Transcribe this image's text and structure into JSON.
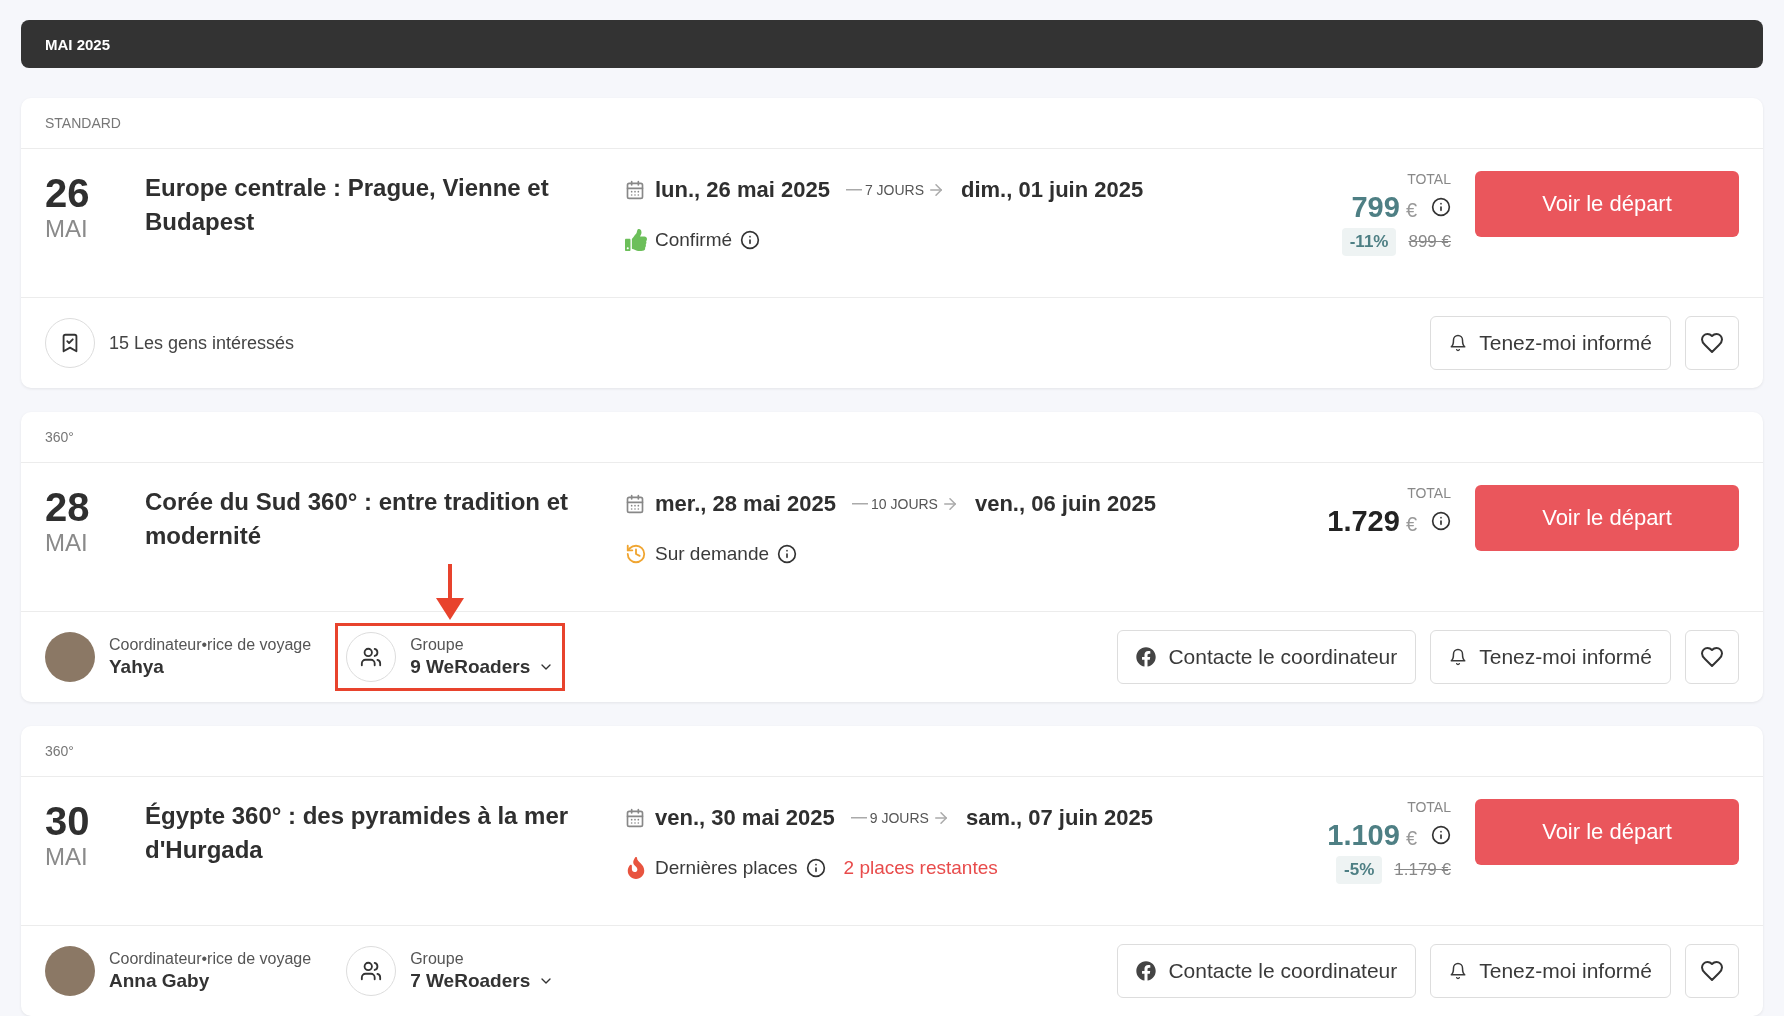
{
  "month_header": "MAI 2025",
  "departures": [
    {
      "category": "STANDARD",
      "day": "26",
      "month": "MAI",
      "title": "Europe centrale : Prague, Vienne et Budapest",
      "start_date": "lun., 26 mai 2025",
      "duration": "7 JOURS",
      "end_date": "dim., 01 juin 2025",
      "status": {
        "kind": "confirmed",
        "label": "Confirmé"
      },
      "total_label": "TOTAL",
      "price": "799",
      "currency": "€",
      "discount": "-11%",
      "old_price": "899 €",
      "cta": "Voir le départ",
      "interested": "15 Les gens intéressés",
      "notify": "Tenez-moi informé"
    },
    {
      "category": "360°",
      "day": "28",
      "month": "MAI",
      "title": "Corée du Sud 360° : entre tradition et modernité",
      "start_date": "mer., 28 mai 2025",
      "duration": "10 JOURS",
      "end_date": "ven., 06 juin 2025",
      "status": {
        "kind": "on_request",
        "label": "Sur demande"
      },
      "total_label": "TOTAL",
      "price": "1.729",
      "currency": "€",
      "cta": "Voir le départ",
      "coordinator": {
        "role": "Coordinateur•rice de voyage",
        "name": "Yahya"
      },
      "group": {
        "label": "Groupe",
        "value": "9 WeRoaders",
        "highlighted": true
      },
      "contact": "Contacte le coordinateur",
      "notify": "Tenez-moi informé"
    },
    {
      "category": "360°",
      "day": "30",
      "month": "MAI",
      "title": "Égypte 360° : des pyramides à la mer d'Hurgada",
      "start_date": "ven., 30 mai 2025",
      "duration": "9 JOURS",
      "end_date": "sam., 07 juin 2025",
      "status": {
        "kind": "last_places",
        "label": "Dernières places",
        "extra": "2 places restantes"
      },
      "total_label": "TOTAL",
      "price": "1.109",
      "currency": "€",
      "discount": "-5%",
      "old_price": "1.179 €",
      "cta": "Voir le départ",
      "coordinator": {
        "role": "Coordinateur•rice de voyage",
        "name": "Anna Gaby"
      },
      "group": {
        "label": "Groupe",
        "value": "7 WeRoaders",
        "highlighted": false
      },
      "contact": "Contacte le coordinateur",
      "notify": "Tenez-moi informé"
    }
  ]
}
